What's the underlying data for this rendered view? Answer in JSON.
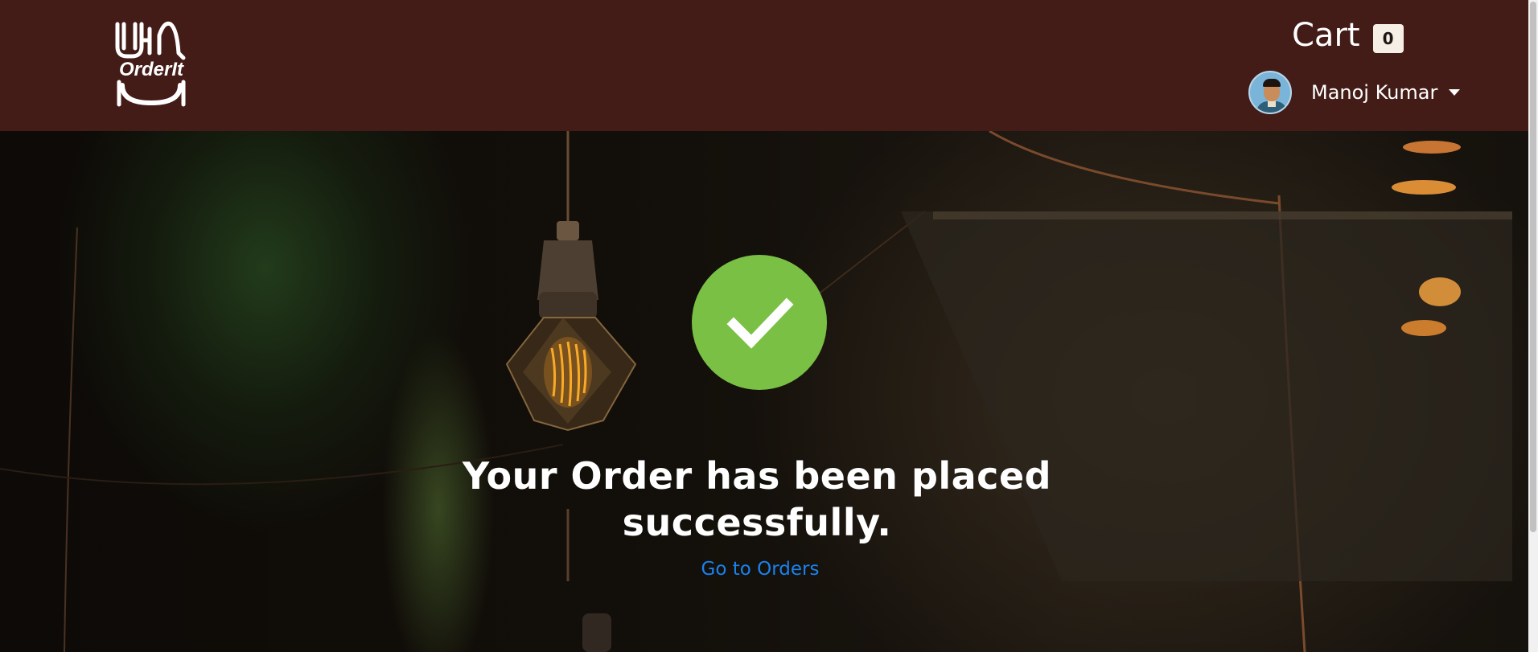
{
  "header": {
    "logo_text": "OrderIt",
    "cart_label": "Cart",
    "cart_count": "0",
    "user_name": "Manoj Kumar"
  },
  "confirmation": {
    "message": "Your Order has been placed successfully.",
    "link_text": "Go to Orders"
  },
  "colors": {
    "navbar": "#431b17",
    "success": "#79c044",
    "link": "#1a82ee"
  },
  "icons": {
    "logo": "orderit-logo",
    "status": "checkmark-icon",
    "dropdown": "caret-down-icon"
  }
}
